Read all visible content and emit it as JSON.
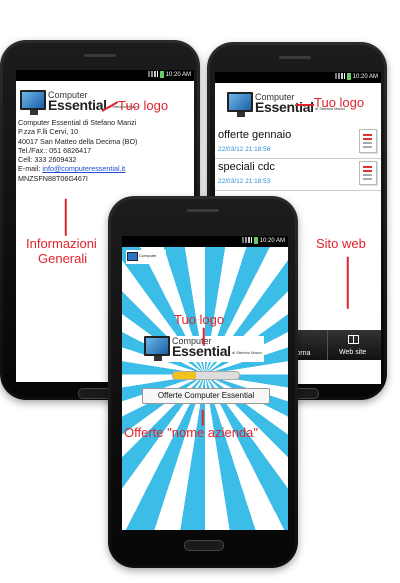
{
  "status": {
    "time": "10:20 AM"
  },
  "logo": {
    "top_text": "Computer",
    "main_text": "Essential",
    "small_text": "di Stefano Manzi"
  },
  "annotations": {
    "tuo_logo": "Tuo logo",
    "informazioni_line1": "Informazioni",
    "informazioni_line2": "Generali",
    "sito_web": "Sito web",
    "offerte_nome": "Offerte \"nome azienda\""
  },
  "left_screen": {
    "lines": [
      "Computer Essential di Stefano Manzi",
      "P.zza F.lli Cervi, 10",
      "40017 San Matteo della Decima (BO)",
      "Tel./Fax.: 051 6826417",
      "Cell: 333 2609432"
    ],
    "email_label": "E-mail: ",
    "email": "info@computeressential.it",
    "code": "MNZSFN88T06G467I"
  },
  "right_screen": {
    "items": [
      {
        "title": "offerte gennaio",
        "date": "22/03/12 21:18:56"
      },
      {
        "title": "speciali cdc",
        "date": "22/03/12 21:18:53"
      }
    ],
    "softkeys": {
      "left": "giorna",
      "right": "Web site"
    }
  },
  "center_screen": {
    "button_label": "Offerte Computer Essential",
    "progress": 0.35
  },
  "colors": {
    "annotation": "#e0232d",
    "sunburst_blue": "#3bbde8",
    "date_blue": "#2d8fd3"
  }
}
